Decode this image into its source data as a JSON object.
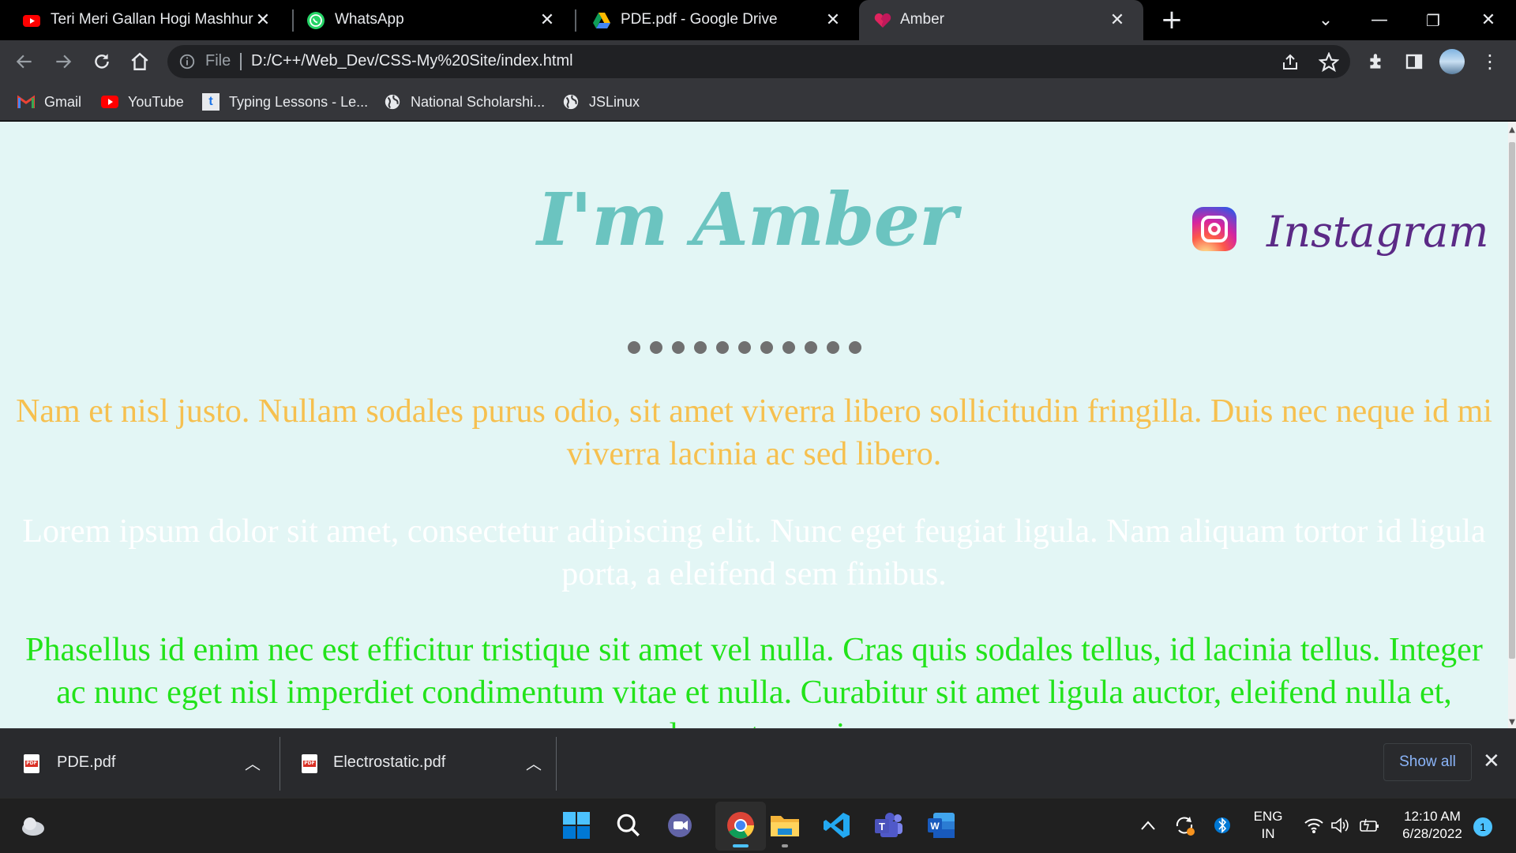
{
  "browser": {
    "tabs": [
      {
        "title": "Teri Meri Gallan Hogi Mashhur | (",
        "icon": "youtube-icon",
        "active": false
      },
      {
        "title": "WhatsApp",
        "icon": "whatsapp-icon",
        "active": false
      },
      {
        "title": "PDE.pdf - Google Drive",
        "icon": "google-drive-icon",
        "active": false
      },
      {
        "title": "Amber",
        "icon": "broken-heart-icon",
        "active": true
      }
    ],
    "new_tab_label": "+",
    "address": {
      "scheme_label": "File",
      "url": "D:/C++/Web_Dev/CSS-My%20Site/index.html"
    },
    "bookmarks": [
      {
        "label": "Gmail",
        "icon": "gmail-icon"
      },
      {
        "label": "YouTube",
        "icon": "youtube-icon"
      },
      {
        "label": "Typing Lessons - Le...",
        "icon": "typing-icon"
      },
      {
        "label": "National Scholarshi...",
        "icon": "globe-icon"
      },
      {
        "label": "JSLinux",
        "icon": "globe-icon"
      }
    ]
  },
  "page": {
    "title": "I'm Amber",
    "instagram_label": "Instagram",
    "dots_count": 11,
    "paragraphs": [
      {
        "text": "Nam et nisl justo. Nullam sodales purus odio, sit amet viverra libero sollicitudin fringilla. Duis nec neque id mi viverra lacinia ac sed libero.",
        "color": "#f6c04f"
      },
      {
        "text": "Lorem ipsum dolor sit amet, consectetur adipiscing elit. Nunc eget feugiat ligula. Nam aliquam tortor id ligula porta, a eleifend sem finibus.",
        "color": "#ffffff"
      },
      {
        "text": "Phasellus id enim nec est efficitur tristique sit amet vel nulla. Cras quis sodales tellus, id lacinia tellus. Integer ac nunc eget nisl imperdiet condimentum vitae et nulla. Curabitur sit amet ligula auctor, eleifend nulla et, elementum mi.",
        "color": "#22e31a"
      }
    ],
    "background": "#e3f6f5"
  },
  "downloads": {
    "items": [
      {
        "name": "PDE.pdf",
        "icon": "pdf-icon"
      },
      {
        "name": "Electrostatic.pdf",
        "icon": "pdf-icon"
      }
    ],
    "show_all_label": "Show all"
  },
  "taskbar": {
    "language_line1": "ENG",
    "language_line2": "IN",
    "time": "12:10 AM",
    "date": "6/28/2022",
    "notification_count": "1"
  }
}
